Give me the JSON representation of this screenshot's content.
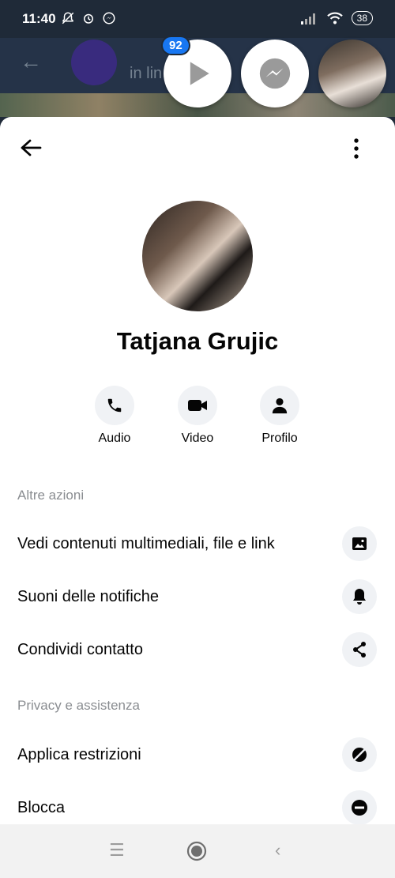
{
  "status_bar": {
    "time": "11:40",
    "battery": "38",
    "icons": [
      "notifications-off-icon",
      "alarm-icon",
      "messenger-icon",
      "signal-icon",
      "wifi-icon",
      "battery-icon"
    ]
  },
  "background_chat": {
    "status_text": "in lin",
    "notification_count": "92"
  },
  "profile": {
    "name": "Tatjana Grujic"
  },
  "actions": [
    {
      "label": "Audio",
      "icon": "phone-icon"
    },
    {
      "label": "Video",
      "icon": "video-camera-icon"
    },
    {
      "label": "Profilo",
      "icon": "person-icon"
    }
  ],
  "sections": {
    "more_actions": "Altre azioni",
    "privacy": "Privacy e assistenza"
  },
  "menu_items": [
    {
      "label": "Vedi contenuti multimediali, file e link",
      "icon": "image-icon"
    },
    {
      "label": "Suoni delle notifiche",
      "icon": "bell-icon"
    },
    {
      "label": "Condividi contatto",
      "icon": "share-icon"
    },
    {
      "label": "Applica restrizioni",
      "icon": "restrict-icon"
    },
    {
      "label": "Blocca",
      "icon": "block-icon"
    }
  ],
  "colors": {
    "accent": "#1877f2",
    "sheet_bg": "#ffffff",
    "icon_bg": "#f0f2f5",
    "section_text": "#8a8d91"
  }
}
